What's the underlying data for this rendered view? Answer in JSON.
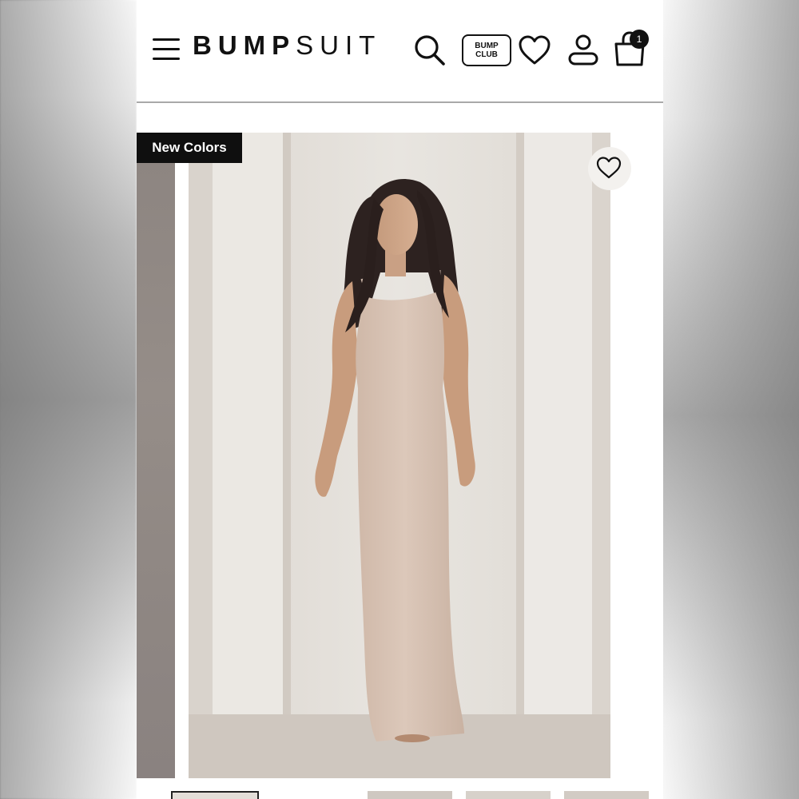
{
  "header": {
    "logo_bold": "BUMP",
    "logo_light": "SUIT",
    "club_line1": "BUMP",
    "club_line2": "CLUB",
    "cart_count": "1"
  },
  "product_gallery": {
    "badge": "New Colors",
    "photo_description_icon": "product-photo"
  },
  "icons": [
    "menu-icon",
    "search-icon",
    "heart-icon",
    "user-icon",
    "bag-icon",
    "heart-icon"
  ],
  "colors": {
    "accent": "#111111",
    "dress": "#d8c3b4",
    "wall": "#e7e4df"
  }
}
